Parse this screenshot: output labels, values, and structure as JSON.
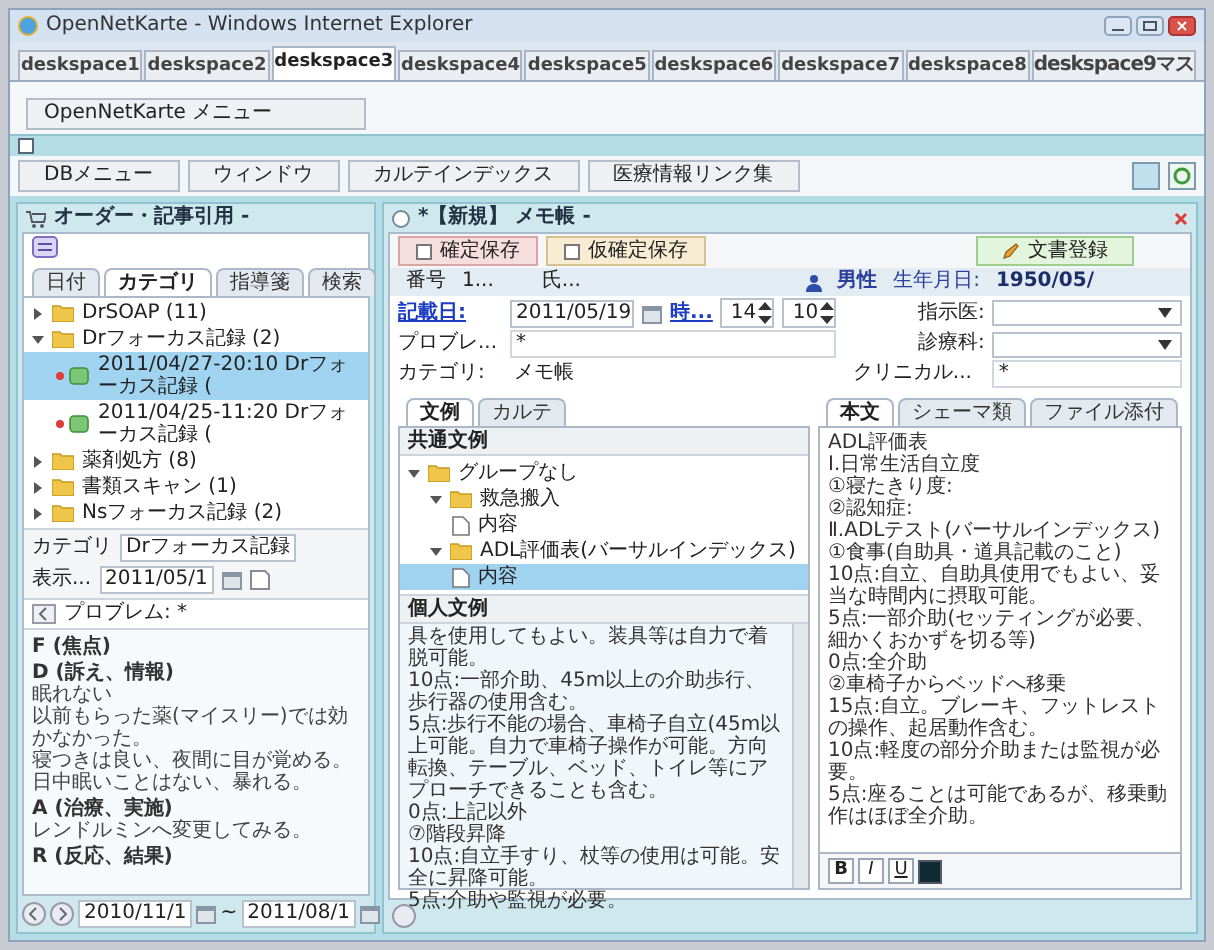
{
  "window": {
    "title": "OpenNetKarte - Windows Internet Explorer"
  },
  "deskspace_tabs": [
    {
      "label": "deskspace1",
      "selected": false
    },
    {
      "label": "deskspace2",
      "selected": false
    },
    {
      "label": "deskspace3",
      "selected": true
    },
    {
      "label": "deskspace4",
      "selected": false
    },
    {
      "label": "deskspace5",
      "selected": false
    },
    {
      "label": "deskspace6",
      "selected": false
    },
    {
      "label": "deskspace7",
      "selected": false
    },
    {
      "label": "deskspace8",
      "selected": false
    },
    {
      "label": "deskspace9マス",
      "selected": false
    }
  ],
  "menu_button": "OpenNetKarte メニュー",
  "toolbar": [
    "DBメニュー",
    "ウィンドウ",
    "カルテインデックス",
    "医療情報リンク集"
  ],
  "left_panel": {
    "title": "オーダー・記事引用 -",
    "tabs": [
      {
        "label": "日付",
        "selected": false
      },
      {
        "label": "カテゴリ",
        "selected": true
      },
      {
        "label": "指導箋",
        "selected": false
      },
      {
        "label": "検索",
        "selected": false
      }
    ],
    "tree": [
      {
        "label": "DrSOAP (11)",
        "kind": "folder",
        "expanded": false,
        "selected": false
      },
      {
        "label": "Drフォーカス記録 (2)",
        "kind": "folder",
        "expanded": true,
        "selected": false,
        "children": [
          {
            "label": "2011/04/27-20:10 Drフォーカス記録 (",
            "kind": "record",
            "selected": true
          },
          {
            "label": "2011/04/25-11:20 Drフォーカス記録 (",
            "kind": "record",
            "selected": false
          }
        ]
      },
      {
        "label": "薬剤処方 (8)",
        "kind": "folder",
        "expanded": false,
        "selected": false
      },
      {
        "label": "書類スキャン (1)",
        "kind": "folder",
        "expanded": false,
        "selected": false
      },
      {
        "label": "Nsフォーカス記録 (2)",
        "kind": "folder",
        "expanded": false,
        "selected": false
      }
    ],
    "category_label": "カテゴリ",
    "category_value": "Drフォーカス記録",
    "display_label": "表示...",
    "date": "2011/05/1",
    "problem": "プロブレム: *",
    "note": [
      {
        "kind": "heading",
        "text": "F (焦点)"
      },
      {
        "kind": "heading",
        "text": "D (訴え、情報)"
      },
      {
        "kind": "text",
        "text": "眠れない"
      },
      {
        "kind": "text",
        "text": "以前もらった薬(マイスリー)では効かなかった。"
      },
      {
        "kind": "text",
        "text": "寝つきは良い、夜間に目が覚める。日中眠いことはない、暴れる。"
      },
      {
        "kind": "heading",
        "text": "A (治療、実施)"
      },
      {
        "kind": "text",
        "text": "レンドルミンへ変更してみる。"
      },
      {
        "kind": "heading",
        "text": "R (反応、結果)"
      }
    ],
    "date_from": "2010/11/1",
    "range_sep": "~",
    "date_to": "2011/08/1"
  },
  "memo_window": {
    "title": "*【新規】 メモ帳 -",
    "buttons": [
      {
        "label": "確定保存",
        "kind": "confirm"
      },
      {
        "label": "仮確定保存",
        "kind": "draft"
      }
    ],
    "register_button": "文書登録",
    "patient": {
      "id_label": "番号",
      "id": "1...",
      "name": "氏...",
      "sex": "男性",
      "birth_label": "生年月日:",
      "birth": "1950/05/"
    },
    "date_label": "記載日:",
    "date": "2011/05/19",
    "time_label": "時...",
    "hour": "14",
    "minute": "10",
    "doctor_label": "指示医:",
    "problem_label": "プロブレ...",
    "problem": "*",
    "dept_label": "診療科:",
    "category_label": "カテゴリ:",
    "category": "メモ帳",
    "clinical_label": "クリニカル...",
    "clinical": "*",
    "example_tabs": [
      {
        "label": "文例",
        "selected": true
      },
      {
        "label": "カルテ",
        "selected": false
      }
    ],
    "common_header": "共通文例",
    "example_tree": [
      {
        "label": "グループなし",
        "kind": "folder",
        "expanded": true,
        "selected": false,
        "children": [
          {
            "label": "救急搬入",
            "kind": "folder",
            "expanded": true,
            "selected": false,
            "children": [
              {
                "label": "内容",
                "kind": "document",
                "selected": false
              }
            ]
          },
          {
            "label": "ADL評価表(バーサルインデックス)",
            "kind": "folder",
            "expanded": true,
            "selected": false,
            "children": [
              {
                "label": "内容",
                "kind": "document",
                "selected": true
              }
            ]
          }
        ]
      }
    ],
    "personal_header": "個人文例",
    "personal_text": [
      "具を使用してもよい。装具等は自力で着脱可能。",
      "10点:一部介助、45m以上の介助歩行、歩行器の使用含む。",
      "5点:歩行不能の場合、車椅子自立(45m以上可能。自力で車椅子操作が可能。方向転換、テーブル、ベッド、トイレ等にアプローチできることも含む。",
      "0点:上記以外",
      "⑦階段昇降",
      "10点:自立手すり、杖等の使用は可能。安全に昇降可能。",
      "5点:介助や監視が必要。"
    ],
    "body_tabs": [
      {
        "label": "本文",
        "selected": true
      },
      {
        "label": "シェーマ類",
        "selected": false
      },
      {
        "label": "ファイル添付",
        "selected": false
      }
    ],
    "body_text": [
      "ADL評価表",
      "Ⅰ.日常生活自立度",
      "①寝たきり度:",
      "②認知症:",
      "Ⅱ.ADLテスト(バーサルインデックス)",
      "①食事(自助具・道具記載のこと)",
      "10点:自立、自助具使用でもよい、妥当な時間内に摂取可能。",
      "5点:一部介助(セッティングが必要、細かくおかずを切る等)",
      "0点:全介助",
      "②車椅子からベッドへ移乗",
      "15点:自立。ブレーキ、フットレストの操作、起居動作含む。",
      "10点:軽度の部分介助または監視が必要。",
      "5点:座ることは可能であるが、移乗動作はほぼ全介助。"
    ],
    "format_buttons": [
      "B",
      "I",
      "U"
    ]
  }
}
